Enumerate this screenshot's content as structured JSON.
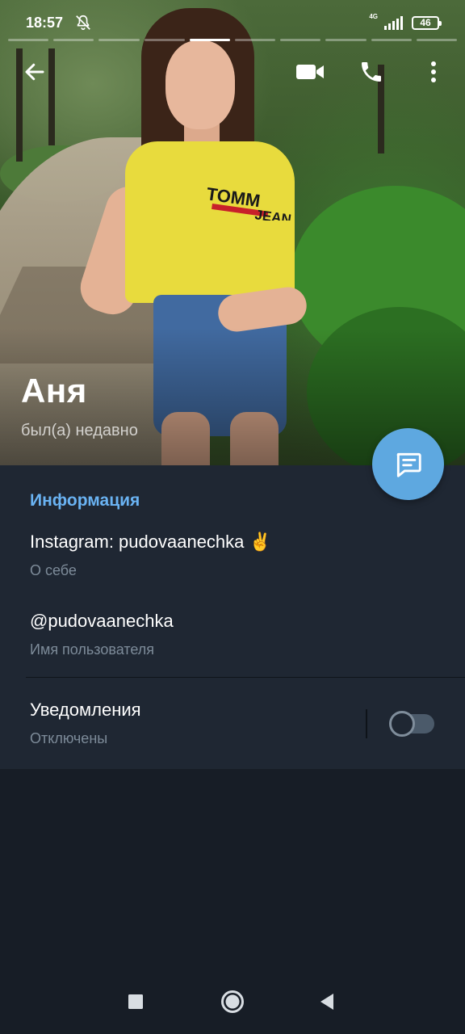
{
  "status_bar": {
    "time": "18:57",
    "network": "4G",
    "battery": "46"
  },
  "story": {
    "segments": 10,
    "active_segment": 5
  },
  "toolbar": {
    "back_icon": "arrow-left-icon",
    "video_icon": "video-camera-icon",
    "call_icon": "phone-icon",
    "more_icon": "more-vertical-icon"
  },
  "profile": {
    "name": "Аня",
    "last_seen": "был(а) недавно"
  },
  "info": {
    "section_title": "Информация",
    "bio": "Instagram: pudovaanechka ✌️",
    "bio_label": "О себе",
    "username": "@pudovaanechka",
    "username_label": "Имя пользователя",
    "notifications": "Уведомления",
    "notifications_state": "Отключены",
    "notifications_enabled": false
  },
  "colors": {
    "accent": "#6ab3f3",
    "fab": "#5ea8e0",
    "card": "#1f2733",
    "background": "#171d26"
  }
}
